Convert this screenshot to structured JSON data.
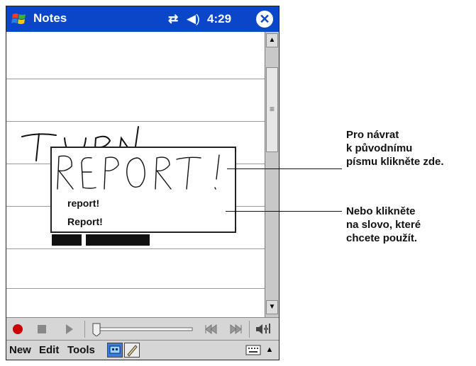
{
  "titlebar": {
    "app_title": "Notes",
    "time": "4:29"
  },
  "popup": {
    "words": [
      "report!",
      "Report!"
    ]
  },
  "command_bar": {
    "menus": [
      "New",
      "Edit",
      "Tools"
    ]
  },
  "callouts": {
    "top": [
      "Pro návrat",
      "k původnímu",
      "písmu klikněte zde."
    ],
    "bottom": [
      "Nebo klikněte",
      "na slovo, které",
      "chcete použít."
    ]
  },
  "icons": [
    "windows-start-icon",
    "connectivity-icon",
    "speaker-icon",
    "close-icon",
    "record-icon",
    "stop-icon",
    "play-icon",
    "rewind-icon",
    "fast-forward-icon",
    "volume-icon",
    "keyboard-icon",
    "pen-icon"
  ],
  "colors": {
    "titlebar": "#0a47c8",
    "record": "#cc0000"
  }
}
